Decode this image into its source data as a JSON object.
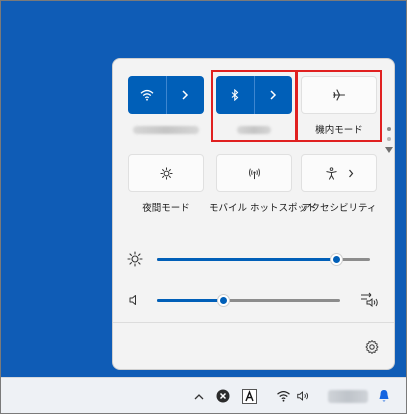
{
  "quick_settings": {
    "tiles": {
      "wifi": {
        "icon": "wifi-icon",
        "expand_icon": "chevron-right-icon",
        "label": ""
      },
      "bluetooth": {
        "icon": "bluetooth-icon",
        "expand_icon": "chevron-right-icon",
        "label": ""
      },
      "airplane": {
        "icon": "airplane-icon",
        "label": "機内モード"
      },
      "night_light": {
        "icon": "brightness-icon",
        "label": "夜間モード"
      },
      "hotspot": {
        "icon": "hotspot-icon",
        "label": "モバイル ホットスポット"
      },
      "accessibility": {
        "icon": "accessibility-icon",
        "expand_icon": "chevron-right-icon",
        "label": "アクセシビリティ"
      }
    },
    "brightness": {
      "icon": "brightness-icon",
      "value_fraction": 0.84
    },
    "volume": {
      "icon": "speaker-icon",
      "value_fraction": 0.36,
      "output_icon": "audio-output-icon"
    },
    "settings_icon": "gear-icon"
  },
  "taskbar": {
    "icons": [
      "chevron-up-icon",
      "close-circle-icon",
      "text-a-icon",
      "wifi-icon",
      "speaker-icon",
      "bell-icon"
    ]
  },
  "colors": {
    "accent": "#005fb8",
    "desktop": "#0f5cb6",
    "highlight": "#e02020",
    "bell": "#1565e0"
  }
}
